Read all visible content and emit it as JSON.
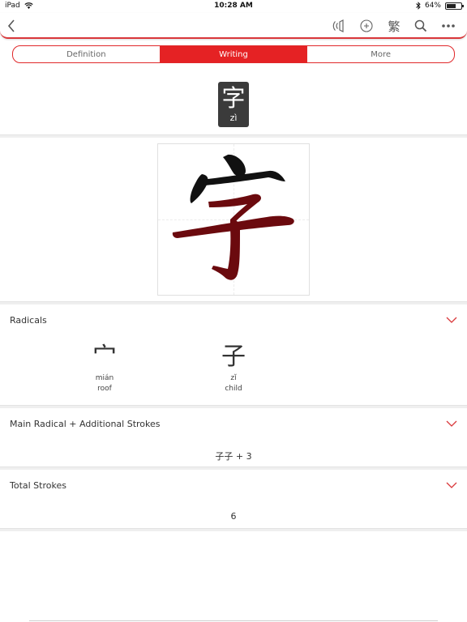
{
  "status_bar": {
    "device": "iPad",
    "time": "10:28 AM",
    "battery": "64%",
    "battery_level": 0.64
  },
  "navbar": {
    "back_icon": "chevron-left-icon",
    "audio_icon": "speaker-icon",
    "add_icon": "plus-circle-icon",
    "traditional_label": "繁",
    "search_icon": "search-icon",
    "more_icon": "more-dots-icon"
  },
  "tabs": [
    {
      "label": "Definition",
      "active": false
    },
    {
      "label": "Writing",
      "active": true
    },
    {
      "label": "More",
      "active": false
    }
  ],
  "character": {
    "hanzi": "字",
    "pinyin": "zì"
  },
  "radicals": {
    "title": "Radicals",
    "items": [
      {
        "glyph": "宀",
        "pinyin": "mián",
        "meaning": "roof"
      },
      {
        "glyph": "子",
        "pinyin": "zǐ",
        "meaning": "child"
      }
    ]
  },
  "main_radical": {
    "title": "Main Radical + Additional Strokes",
    "value": "子子 + 3"
  },
  "total_strokes": {
    "title": "Total Strokes",
    "value": "6"
  },
  "colors": {
    "accent": "#e52224",
    "stroke_done": "#111111",
    "stroke_current": "#6b0a0e"
  }
}
